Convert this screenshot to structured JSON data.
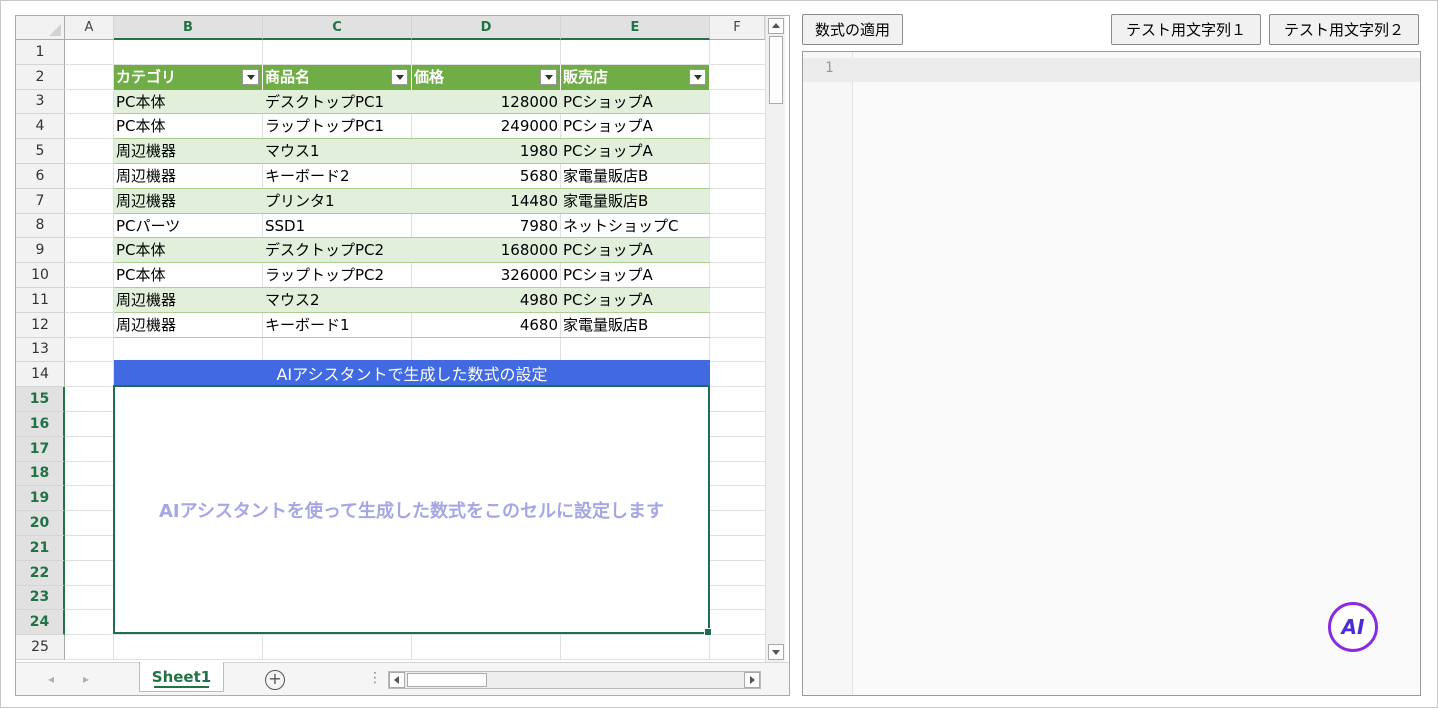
{
  "spreadsheet": {
    "columns": [
      "A",
      "B",
      "C",
      "D",
      "E",
      "F"
    ],
    "selected_columns": [
      "B",
      "C",
      "D",
      "E"
    ],
    "rows": [
      "1",
      "2",
      "3",
      "4",
      "5",
      "6",
      "7",
      "8",
      "9",
      "10",
      "11",
      "12",
      "13",
      "14",
      "15",
      "16",
      "17",
      "18",
      "19",
      "20",
      "21",
      "22",
      "23",
      "24",
      "25"
    ],
    "selected_rows": [
      "15",
      "16",
      "17",
      "18",
      "19",
      "20",
      "21",
      "22",
      "23",
      "24"
    ],
    "table": {
      "headers": [
        "カテゴリ",
        "商品名",
        "価格",
        "販売店"
      ],
      "rows": [
        [
          "PC本体",
          "デスクトップPC1",
          "128000",
          "PCショップA"
        ],
        [
          "PC本体",
          "ラップトップPC1",
          "249000",
          "PCショップA"
        ],
        [
          "周辺機器",
          "マウス1",
          "1980",
          "PCショップA"
        ],
        [
          "周辺機器",
          "キーボード2",
          "5680",
          "家電量販店B"
        ],
        [
          "周辺機器",
          "プリンタ1",
          "14480",
          "家電量販店B"
        ],
        [
          "PCパーツ",
          "SSD1",
          "7980",
          "ネットショップC"
        ],
        [
          "PC本体",
          "デスクトップPC2",
          "168000",
          "PCショップA"
        ],
        [
          "PC本体",
          "ラップトップPC2",
          "326000",
          "PCショップA"
        ],
        [
          "周辺機器",
          "マウス2",
          "4980",
          "PCショップA"
        ],
        [
          "周辺機器",
          "キーボード1",
          "4680",
          "家電量販店B"
        ]
      ],
      "header_color": "#70ad47",
      "band_color": "#e2efda"
    },
    "section_title": "AIアシスタントで生成した数式の設定",
    "section_title_color": "#4169e1",
    "merged_cell_text": "AIアシスタントを使って生成した数式をこのセルに設定します",
    "sheet_tab": "Sheet1",
    "accent": "#217346"
  },
  "toolbar": {
    "apply_formula": "数式の適用",
    "test_string_1": "テスト用文字列１",
    "test_string_2": "テスト用文字列２"
  },
  "editor": {
    "line_number": "1"
  },
  "ai_button": {
    "label": "AI",
    "color": "#8a2be2"
  }
}
